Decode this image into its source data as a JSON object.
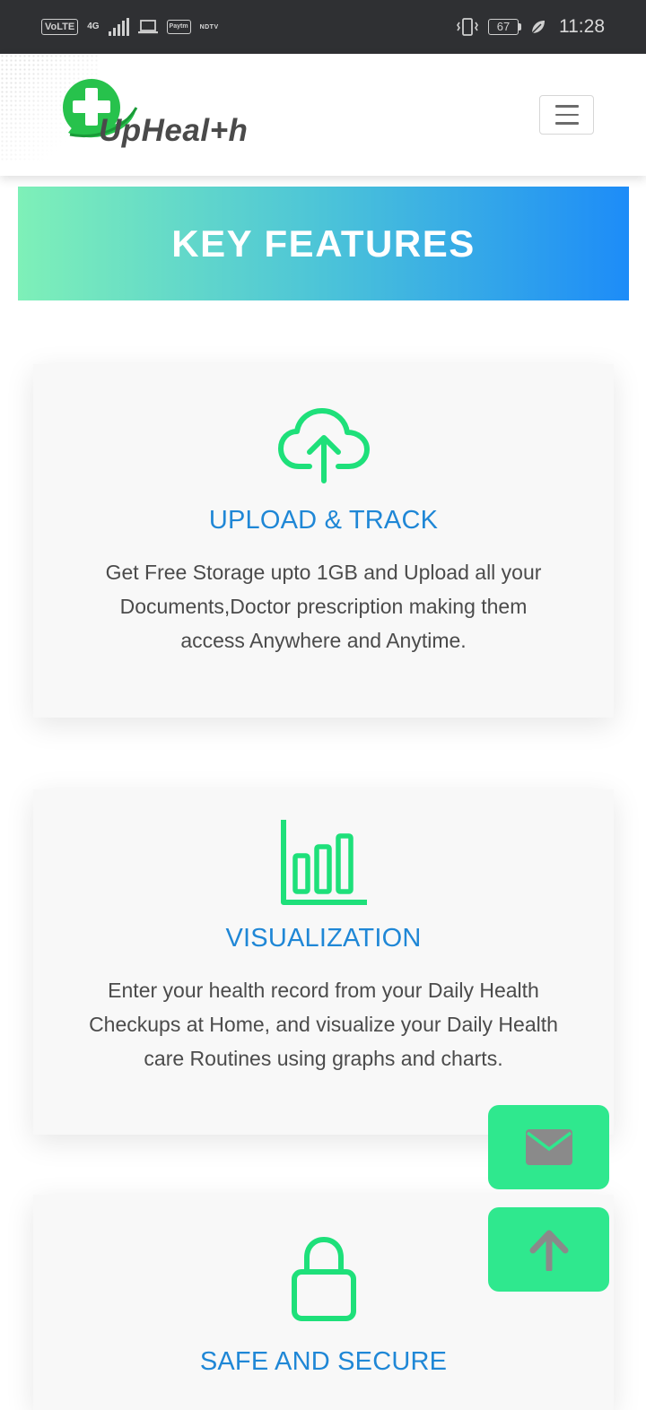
{
  "status_bar": {
    "carrier_chip": "VoLTE",
    "network_type": "4G",
    "app_chip": "Paytm",
    "news_label": "NDTV",
    "battery_level": "67",
    "time": "11:28"
  },
  "header": {
    "logo_text": "UpHeal+h",
    "menu_icon": "hamburger-icon"
  },
  "banner": {
    "title": "KEY FEATURES"
  },
  "features": [
    {
      "icon": "cloud-upload-icon",
      "title": "UPLOAD & TRACK",
      "description": "Get Free Storage upto 1GB and Upload all your Documents,Doctor prescription making them access Anywhere and Anytime."
    },
    {
      "icon": "bar-chart-icon",
      "title": "VISUALIZATION",
      "description": "Enter your health record from your Daily Health Checkups at Home, and visualize your Daily Health care Routines using graphs and charts."
    },
    {
      "icon": "lock-icon",
      "title": "SAFE AND SECURE",
      "description": ""
    }
  ],
  "floating_buttons": {
    "mail_icon": "envelope-icon",
    "top_icon": "arrow-up-icon"
  },
  "colors": {
    "accent_green": "#2fe88e",
    "icon_green": "#1ee07a",
    "title_blue": "#1f87d6",
    "banner_start": "#7ef0b8",
    "banner_end": "#1d8cf8"
  }
}
